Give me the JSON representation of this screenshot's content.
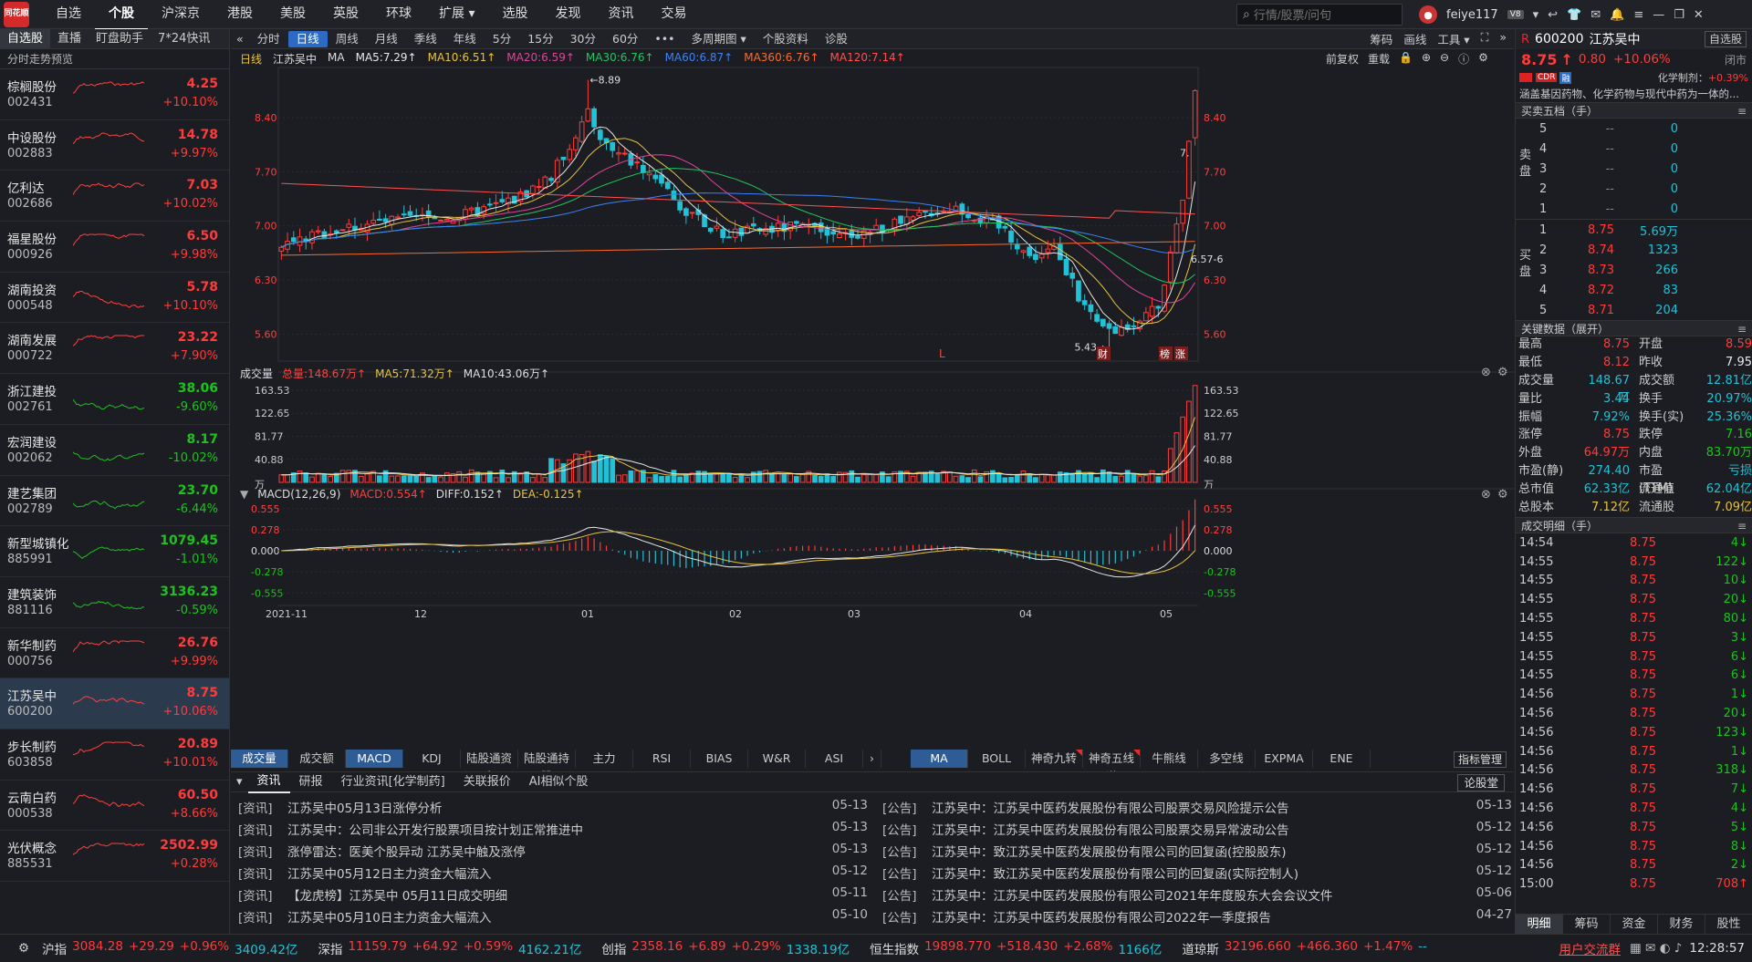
{
  "topbar": {
    "logo": "同花顺",
    "menu": [
      "自选",
      "个股",
      "沪深京",
      "港股",
      "美股",
      "英股",
      "环球",
      "扩展 ▾",
      "选股",
      "发现",
      "资讯",
      "交易"
    ],
    "active": "个股",
    "search_placeholder": "行情/股票/问句",
    "user": "feiye117",
    "level": "V8"
  },
  "left": {
    "tabs": [
      "自选股",
      "直播",
      "盯盘助手",
      "7*24快讯"
    ],
    "active_tab": "自选股",
    "subtitle": "分时走势预览",
    "stocks": [
      {
        "name": "棕榈股份",
        "code": "002431",
        "price": "4.25",
        "pct": "+10.10%",
        "up": true
      },
      {
        "name": "中设股份",
        "code": "002883",
        "price": "14.78",
        "pct": "+9.97%",
        "up": true
      },
      {
        "name": "亿利达",
        "code": "002686",
        "price": "7.03",
        "pct": "+10.02%",
        "up": true
      },
      {
        "name": "福星股份",
        "code": "000926",
        "price": "6.50",
        "pct": "+9.98%",
        "up": true
      },
      {
        "name": "湖南投资",
        "code": "000548",
        "price": "5.78",
        "pct": "+10.10%",
        "up": true
      },
      {
        "name": "湖南发展",
        "code": "000722",
        "price": "23.22",
        "pct": "+7.90%",
        "up": true
      },
      {
        "name": "浙江建投",
        "code": "002761",
        "price": "38.06",
        "pct": "-9.60%",
        "up": false
      },
      {
        "name": "宏润建设",
        "code": "002062",
        "price": "8.17",
        "pct": "-10.02%",
        "up": false
      },
      {
        "name": "建艺集团",
        "code": "002789",
        "price": "23.70",
        "pct": "-6.44%",
        "up": false
      },
      {
        "name": "新型城镇化",
        "code": "885991",
        "price": "1079.45",
        "pct": "-1.01%",
        "up": false
      },
      {
        "name": "建筑装饰",
        "code": "881116",
        "price": "3136.23",
        "pct": "-0.59%",
        "up": false
      },
      {
        "name": "新华制药",
        "code": "000756",
        "price": "26.76",
        "pct": "+9.99%",
        "up": true
      },
      {
        "name": "江苏吴中",
        "code": "600200",
        "price": "8.75",
        "pct": "+10.06%",
        "up": true,
        "selected": true
      },
      {
        "name": "步长制药",
        "code": "603858",
        "price": "20.89",
        "pct": "+10.01%",
        "up": true
      },
      {
        "name": "云南白药",
        "code": "000538",
        "price": "60.50",
        "pct": "+8.66%",
        "up": true
      },
      {
        "name": "光伏概念",
        "code": "885531",
        "price": "2502.99",
        "pct": "+0.28%",
        "up": true
      }
    ]
  },
  "period": {
    "items": [
      "分时",
      "日线",
      "周线",
      "月线",
      "季线",
      "年线",
      "5分",
      "15分",
      "30分",
      "60分",
      "•••",
      "多周期图 ▾",
      "个股资料",
      "诊股"
    ],
    "active": "日线",
    "right": [
      "筹码",
      "画线",
      "工具 ▾"
    ]
  },
  "chart": {
    "type_label": "日线",
    "stock": "江苏吴中",
    "ma_label": "MA",
    "ma": [
      {
        "label": "MA5:7.29↑",
        "color": "#e8e8e8"
      },
      {
        "label": "MA10:6.51↑",
        "color": "#e8c33c"
      },
      {
        "label": "MA20:6.59↑",
        "color": "#e0449a"
      },
      {
        "label": "MA30:6.76↑",
        "color": "#22c55e"
      },
      {
        "label": "MA60:6.87↑",
        "color": "#3b82f6"
      },
      {
        "label": "MA360:6.76↑",
        "color": "#ff6a2a"
      },
      {
        "label": "MA120:7.14↑",
        "color": "#ff5050"
      }
    ],
    "right_tools": [
      "前复权",
      "重载"
    ],
    "y_ticks": [
      "8.40",
      "7.70",
      "7.00",
      "6.30",
      "5.60"
    ],
    "max_label": "←8.89",
    "min_label": "5.43→",
    "right_label": "6.57-6",
    "edge_label": "7.",
    "l_mark": "L",
    "badges": [
      "财",
      "榜",
      "涨"
    ]
  },
  "volume": {
    "title": "成交量",
    "total": "总量:148.67万↑",
    "ma5": "MA5:71.32万↑",
    "ma10": "MA10:43.06万↑",
    "y_ticks": [
      "163.53",
      "122.65",
      "81.77",
      "40.88",
      "万"
    ]
  },
  "macd": {
    "title": "MACD(12,26,9)",
    "macd": "MACD:0.554↑",
    "diff": "DIFF:0.152↑",
    "dea": "DEA:-0.125↑",
    "y_ticks": [
      "0.555",
      "0.278",
      "0.000",
      "-0.278",
      "-0.555"
    ]
  },
  "xaxis": [
    "2021-11",
    "12",
    "01",
    "02",
    "03",
    "04",
    "05"
  ],
  "indicator_tabs": [
    "成交量",
    "成交额",
    "MACD",
    "KDJ",
    "陆股通资金",
    "陆股通持股",
    "主力",
    "RSI",
    "BIAS",
    "W&R",
    "ASI"
  ],
  "indicator_active": "MACD",
  "overlay_tabs": [
    "MA",
    "BOLL",
    "神奇九转",
    "神奇五线谱",
    "牛熊线",
    "多空线",
    "EXPMA",
    "ENE"
  ],
  "overlay_active": "MA",
  "indicator_manage": "指标管理",
  "news": {
    "tabs": [
      "资讯",
      "研报",
      "行业资讯[化学制药]",
      "关联报价",
      "AI相似个股"
    ],
    "active": "资讯",
    "discuss": "论股堂",
    "left": [
      {
        "tag": "[资讯]",
        "title": "江苏吴中05月13日涨停分析",
        "date": "05-13"
      },
      {
        "tag": "[资讯]",
        "title": "江苏吴中：公司非公开发行股票项目按计划正常推进中",
        "date": "05-13"
      },
      {
        "tag": "[资讯]",
        "title": "涨停雷达：医美个股异动 江苏吴中触及涨停",
        "date": "05-13"
      },
      {
        "tag": "[资讯]",
        "title": "江苏吴中05月12日主力资金大幅流入",
        "date": "05-12"
      },
      {
        "tag": "[资讯]",
        "title": "【龙虎榜】江苏吴中 05月11日成交明细",
        "date": "05-11"
      },
      {
        "tag": "[资讯]",
        "title": "江苏吴中05月10日主力资金大幅流入",
        "date": "05-10"
      }
    ],
    "right": [
      {
        "tag": "[公告]",
        "title": "江苏吴中：江苏吴中医药发展股份有限公司股票交易风险提示公告",
        "date": "05-13"
      },
      {
        "tag": "[公告]",
        "title": "江苏吴中：江苏吴中医药发展股份有限公司股票交易异常波动公告",
        "date": "05-12"
      },
      {
        "tag": "[公告]",
        "title": "江苏吴中：致江苏吴中医药发展股份有限公司的回复函(控股股东)",
        "date": "05-12"
      },
      {
        "tag": "[公告]",
        "title": "江苏吴中：致江苏吴中医药发展股份有限公司的回复函(实际控制人)",
        "date": "05-12"
      },
      {
        "tag": "[公告]",
        "title": "江苏吴中：江苏吴中医药发展股份有限公司2021年年度股东大会会议文件",
        "date": "05-06"
      },
      {
        "tag": "[公告]",
        "title": "江苏吴中：江苏吴中医药发展股份有限公司2022年一季度报告",
        "date": "04-27"
      }
    ]
  },
  "right": {
    "market": "R",
    "code": "600200",
    "name": "江苏吴中",
    "btn": "自选股",
    "price": "8.75",
    "arrow": "↑",
    "chg": "0.80",
    "pct": "+10.06%",
    "status": "闭市",
    "tags": [
      "CDR",
      "融"
    ],
    "industry": "化学制剂：",
    "industry_pct": "+0.39%",
    "desc": "涵盖基因药物、化学药物与现代中药为一体的...",
    "ob_title": "买卖五档（手）",
    "sell_label": "卖盘",
    "buy_label": "买盘",
    "sell": [
      {
        "lvl": "5",
        "p": "--",
        "v": "0"
      },
      {
        "lvl": "4",
        "p": "--",
        "v": "0"
      },
      {
        "lvl": "3",
        "p": "--",
        "v": "0"
      },
      {
        "lvl": "2",
        "p": "--",
        "v": "0"
      },
      {
        "lvl": "1",
        "p": "--",
        "v": "0"
      }
    ],
    "buy": [
      {
        "lvl": "1",
        "p": "8.75",
        "v": "5.69万"
      },
      {
        "lvl": "2",
        "p": "8.74",
        "v": "1323"
      },
      {
        "lvl": "3",
        "p": "8.73",
        "v": "266"
      },
      {
        "lvl": "4",
        "p": "8.72",
        "v": "83"
      },
      {
        "lvl": "5",
        "p": "8.71",
        "v": "204"
      }
    ],
    "kd_title": "关键数据（展开）",
    "kd": [
      [
        "最高",
        "8.75",
        "red",
        "开盘",
        "8.59",
        "red"
      ],
      [
        "最低",
        "8.12",
        "red",
        "昨收",
        "7.95",
        "wht"
      ],
      [
        "成交量",
        "148.67万",
        "cyan",
        "成交额",
        "12.81亿",
        "cyan"
      ],
      [
        "量比",
        "3.44",
        "cyan",
        "换手",
        "20.97%",
        "cyan"
      ],
      [
        "振幅",
        "7.92%",
        "cyan",
        "换手(实)",
        "25.36%",
        "cyan"
      ],
      [
        "涨停",
        "8.75",
        "red",
        "跌停",
        "7.16",
        "grn"
      ],
      [
        "外盘",
        "64.97万",
        "red",
        "内盘",
        "83.70万",
        "grn"
      ],
      [
        "市盈(静)",
        "274.40",
        "cyan",
        "市盈(TTM)",
        "亏损",
        "cyan"
      ],
      [
        "总市值",
        "62.33亿",
        "cyan",
        "流通值",
        "62.04亿",
        "cyan"
      ],
      [
        "总股本",
        "7.12亿",
        "yel",
        "流通股",
        "7.09亿",
        "yel"
      ]
    ],
    "trades_title": "成交明细（手）",
    "trades": [
      [
        "14:54",
        "8.75",
        "4↓"
      ],
      [
        "14:55",
        "8.75",
        "122↓"
      ],
      [
        "14:55",
        "8.75",
        "10↓"
      ],
      [
        "14:55",
        "8.75",
        "20↓"
      ],
      [
        "14:55",
        "8.75",
        "80↓"
      ],
      [
        "14:55",
        "8.75",
        "3↓"
      ],
      [
        "14:55",
        "8.75",
        "6↓"
      ],
      [
        "14:55",
        "8.75",
        "6↓"
      ],
      [
        "14:56",
        "8.75",
        "1↓"
      ],
      [
        "14:56",
        "8.75",
        "20↓"
      ],
      [
        "14:56",
        "8.75",
        "123↓"
      ],
      [
        "14:56",
        "8.75",
        "1↓"
      ],
      [
        "14:56",
        "8.75",
        "318↓"
      ],
      [
        "14:56",
        "8.75",
        "7↓"
      ],
      [
        "14:56",
        "8.75",
        "4↓"
      ],
      [
        "14:56",
        "8.75",
        "5↓"
      ],
      [
        "14:56",
        "8.75",
        "8↓"
      ],
      [
        "14:56",
        "8.75",
        "2↓"
      ],
      [
        "15:00",
        "8.75",
        "708↑"
      ]
    ],
    "tabs": [
      "明细",
      "筹码",
      "资金",
      "财务",
      "股性"
    ],
    "active_tab": "明细"
  },
  "status": {
    "indices": [
      {
        "name": "沪指",
        "val": "3084.28",
        "chg": "+29.29",
        "pct": "+0.96%",
        "amt": "3409.42亿"
      },
      {
        "name": "深指",
        "val": "11159.79",
        "chg": "+64.92",
        "pct": "+0.59%",
        "amt": "4162.21亿"
      },
      {
        "name": "创指",
        "val": "2358.16",
        "chg": "+6.89",
        "pct": "+0.29%",
        "amt": "1338.19亿"
      },
      {
        "name": "恒生指数",
        "val": "19898.770",
        "chg": "+518.430",
        "pct": "+2.68%",
        "amt": "1166亿"
      },
      {
        "name": "道琼斯",
        "val": "32196.660",
        "chg": "+466.360",
        "pct": "+1.47%",
        "amt": "--"
      }
    ],
    "link": "用户交流群",
    "time": "12:28:57"
  }
}
